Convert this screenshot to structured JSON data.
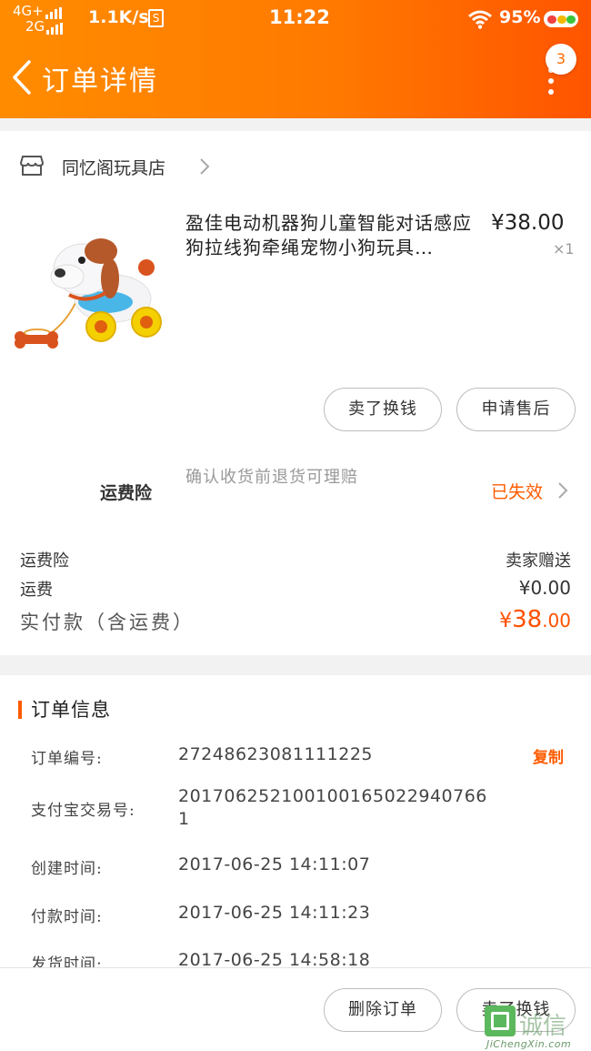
{
  "status_bar": {
    "network_top": "4G+",
    "network_bottom": "2G",
    "speed": "1.1K/s",
    "s_icon": "S",
    "time": "11:22",
    "battery": "95%"
  },
  "nav": {
    "title": "订单详情",
    "badge": "3"
  },
  "shop": {
    "name": "同忆阁玩具店"
  },
  "product": {
    "title": "盈佳电动机器狗儿童智能对话感应狗拉线狗牵绳宠物小狗玩具…",
    "price": "¥38.00",
    "qty": "×1",
    "image_icon": "toy-dog-image"
  },
  "item_actions": {
    "sell": "卖了换钱",
    "after_sale": "申请售后"
  },
  "insurance": {
    "label": "运费险",
    "desc": "确认收货前退货可理赔",
    "status": "已失效"
  },
  "fees": {
    "insurance_label": "运费险",
    "insurance_value": "卖家赠送",
    "shipping_label": "运费",
    "shipping_value": "¥0.00",
    "total_label": "实付款（含运费）",
    "total_currency": "¥",
    "total_int": "38",
    "total_dec": ".00"
  },
  "order_info": {
    "title": "订单信息",
    "copy": "复制",
    "rows": [
      {
        "label": "订单编号:",
        "value": "27248623081111225"
      },
      {
        "label": "支付宝交易号:",
        "value": "2017062521001001650229407661"
      },
      {
        "label": "创建时间:",
        "value": "2017-06-25 14:11:07"
      },
      {
        "label": "付款时间:",
        "value": "2017-06-25 14:11:23"
      },
      {
        "label": "发货时间:",
        "value": "2017-06-25 14:58:18"
      }
    ]
  },
  "bottom": {
    "delete": "删除订单",
    "sell": "卖了换钱"
  },
  "watermark": {
    "cn": "诚信",
    "en": "JiChengXin.com"
  },
  "colors": {
    "accent": "#ff6a00",
    "price_red": "#ff5000",
    "header_start": "#ff8c00",
    "header_end": "#ff5400"
  }
}
